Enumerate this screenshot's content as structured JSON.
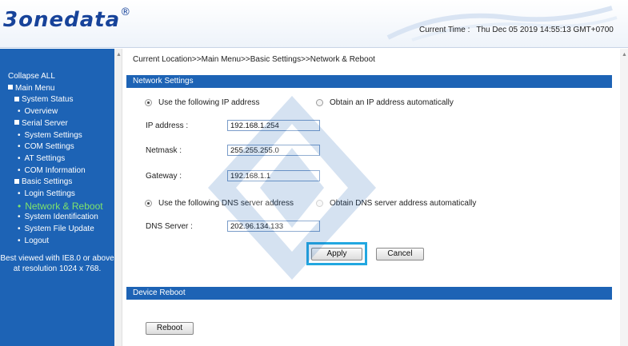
{
  "header": {
    "logo_text": "3onedata",
    "logo_mark": "®",
    "time_label": "Current Time :",
    "time_value": "Thu Dec 05 2019 14:55:13 GMT+0700"
  },
  "sidebar": {
    "collapse_all": "Collapse ALL",
    "main_menu": "Main Menu",
    "groups": [
      {
        "label": "System Status",
        "items": [
          "Overview"
        ]
      },
      {
        "label": "Serial Server",
        "items": [
          "System Settings",
          "COM Settings",
          "AT Settings",
          "COM Information"
        ]
      },
      {
        "label": "Basic Settings",
        "items": [
          "Login Settings",
          "Network & Reboot",
          "System Identification",
          "System File Update",
          "Logout"
        ]
      }
    ],
    "active_item": "Network & Reboot",
    "best_viewed_line1": "Best viewed with IE8.0 or above",
    "best_viewed_line2": "at resolution 1024 x 768."
  },
  "main": {
    "breadcrumb": "Current Location>>Main Menu>>Basic Settings>>Network & Reboot",
    "network_settings": {
      "title": "Network Settings",
      "ip_option_manual": "Use the following IP address",
      "ip_option_auto": "Obtain an IP address automatically",
      "ip_label": "IP address :",
      "ip_value": "192.168.1.254",
      "netmask_label": "Netmask :",
      "netmask_value": "255.255.255.0",
      "gateway_label": "Gateway :",
      "gateway_value": "192.168.1.1",
      "dns_option_manual": "Use the following DNS server address",
      "dns_option_auto": "Obtain DNS server address automatically",
      "dns_label": "DNS Server :",
      "dns_value": "202.96.134.133",
      "apply_label": "Apply",
      "cancel_label": "Cancel"
    },
    "device_reboot": {
      "title": "Device Reboot",
      "reboot_label": "Reboot"
    }
  },
  "colors": {
    "sidebar_bg": "#1d63b5",
    "section_bar": "#1d63b5",
    "active_menu": "#7fe36b",
    "logo": "#17439a",
    "apply_highlight": "#22a7e0"
  },
  "icons": [
    "collapse-box-icon",
    "bullet-icon",
    "radio-checked-icon",
    "radio-unchecked-icon",
    "scroll-up-arrow-icon"
  ]
}
